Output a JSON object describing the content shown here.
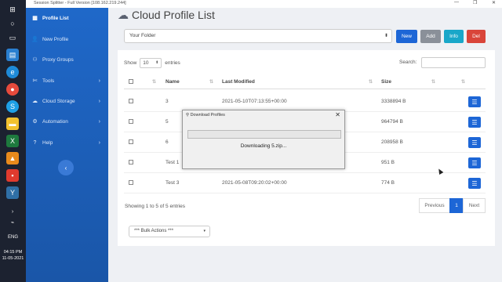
{
  "window": {
    "title": "Session Splitter - Full Version [108.162.219.244]",
    "controls": [
      "—",
      "❐",
      "✕"
    ]
  },
  "taskbar": {
    "time": "04:15 PM",
    "date": "11-05-2021",
    "lang": "ENG",
    "icons": [
      "windows-icon",
      "search-icon",
      "task-view-icon",
      "store-icon",
      "edge-icon",
      "chrome-icon",
      "skype-icon",
      "file-explorer-icon",
      "excel-icon",
      "vlc-icon",
      "app-icon"
    ]
  },
  "sidebar": {
    "items": [
      {
        "label": "Profile List",
        "icon": "list-icon",
        "active": true
      },
      {
        "label": "New Profile",
        "icon": "user-icon"
      },
      {
        "label": "Proxy Groups",
        "icon": "group-icon"
      },
      {
        "label": "Tools",
        "icon": "tools-icon",
        "chevron": true
      },
      {
        "label": "Cloud Storage",
        "icon": "cloud-icon",
        "chevron": true
      },
      {
        "label": "Automation",
        "icon": "automation-icon",
        "chevron": true
      },
      {
        "label": "Help",
        "icon": "help-icon",
        "chevron": true
      }
    ],
    "collapse": "‹"
  },
  "header": {
    "title": "Cloud Profile List"
  },
  "toolbar": {
    "folder_value": "Your Folder",
    "new_label": "New",
    "add_label": "Add",
    "info_label": "Info",
    "del_label": "Del",
    "colors": {
      "new": "#1d66d6",
      "add": "#8a9099",
      "info": "#19a7c9",
      "del": "#d9453a"
    }
  },
  "table": {
    "show_label": "Show",
    "entries_value": "10",
    "entries_label": "entries",
    "search_label": "Search:",
    "columns": [
      "Name",
      "Last Modified",
      "Size"
    ],
    "rows": [
      {
        "name": "3",
        "modified": "2021-05-10T07:13:55+00:00",
        "size": "3338894 B"
      },
      {
        "name": "5",
        "modified": "",
        "size": "964794 B"
      },
      {
        "name": "6",
        "modified": "",
        "size": "208958 B"
      },
      {
        "name": "Test 1",
        "modified": "",
        "size": "951 B"
      },
      {
        "name": "Test 3",
        "modified": "2021-05-08T09:20:02+00:00",
        "size": "774 B"
      }
    ],
    "showing": "Showing 1 to 5 of 5 entries",
    "pagination": {
      "previous": "Previous",
      "current": "1",
      "next": "Next"
    }
  },
  "bulk_actions": {
    "value": "*** Bulk Actions ***"
  },
  "dialog": {
    "title": "Download Profiles",
    "message": "Downloading 5.zip...",
    "progress": 0.0
  }
}
